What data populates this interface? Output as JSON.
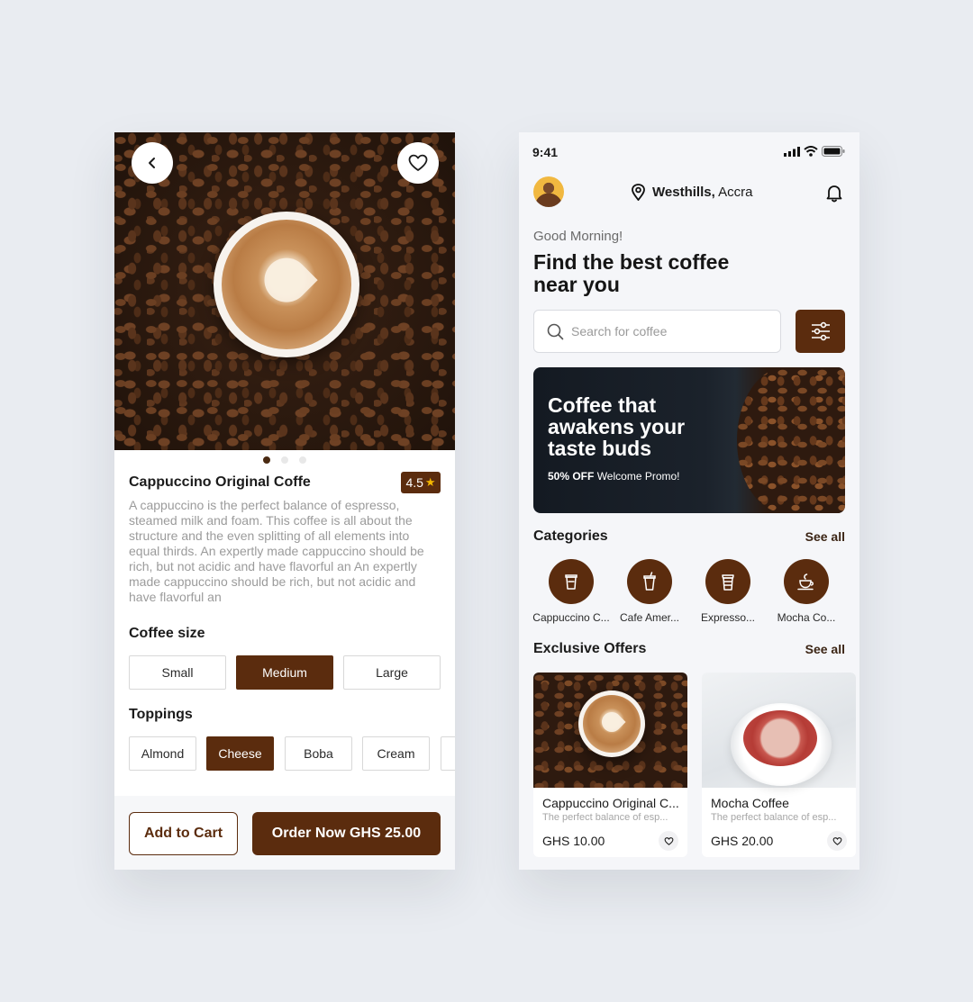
{
  "detail": {
    "back_icon": "chevron-left-icon",
    "favorite_icon": "heart-outline-icon",
    "carousel": {
      "count": 3,
      "active": 1
    },
    "title": "Cappuccino Original Coffe",
    "rating": "4.5",
    "description": "A cappuccino is the perfect balance of espresso, steamed milk and foam. This coffee is all about the structure and the even splitting of all elements into equal thirds. An expertly made cappuccino should be rich, but not acidic and have flavorful an  An expertly made cappuccino should be rich, but not acidic and have flavorful an",
    "size_label": "Coffee size",
    "sizes": [
      {
        "label": "Small",
        "selected": false
      },
      {
        "label": "Medium",
        "selected": true
      },
      {
        "label": "Large",
        "selected": false
      }
    ],
    "toppings_label": "Toppings",
    "toppings": [
      {
        "label": "Almond",
        "selected": false
      },
      {
        "label": "Cheese",
        "selected": true
      },
      {
        "label": "Boba",
        "selected": false
      },
      {
        "label": "Cream",
        "selected": false
      }
    ],
    "add_to_cart": "Add to Cart",
    "order_now": "Order Now GHS 25.00"
  },
  "home": {
    "status_time": "9:41",
    "location_bold": "Westhills,",
    "location_rest": " Accra",
    "greeting": "Good Morning!",
    "headline": "Find the best coffee near you",
    "search_placeholder": "Search for coffee",
    "promo": {
      "title": "Coffee that awakens your taste buds",
      "discount": "50% OFF",
      "subtitle": " Welcome Promo!"
    },
    "categories_title": "Categories",
    "categories_see_all": "See all",
    "categories": [
      {
        "label": "Cappuccino C...",
        "icon": "takeaway-cup-icon"
      },
      {
        "label": "Cafe Amer...",
        "icon": "iced-cup-icon"
      },
      {
        "label": "Expresso...",
        "icon": "coffee-cup-lid-icon"
      },
      {
        "label": "Mocha Co...",
        "icon": "latte-cup-icon"
      }
    ],
    "offers_title": "Exclusive Offers",
    "offers_see_all": "See all",
    "offers": [
      {
        "name": "Cappuccino Original C...",
        "desc": "The perfect balance of esp...",
        "price": "GHS 10.00"
      },
      {
        "name": "Mocha Coffee",
        "desc": "The perfect balance of esp...",
        "price": "GHS 20.00"
      }
    ]
  },
  "colors": {
    "brand": "#5b2c0e",
    "background": "#e9ecf1",
    "muted_text": "#9b9b9b"
  }
}
